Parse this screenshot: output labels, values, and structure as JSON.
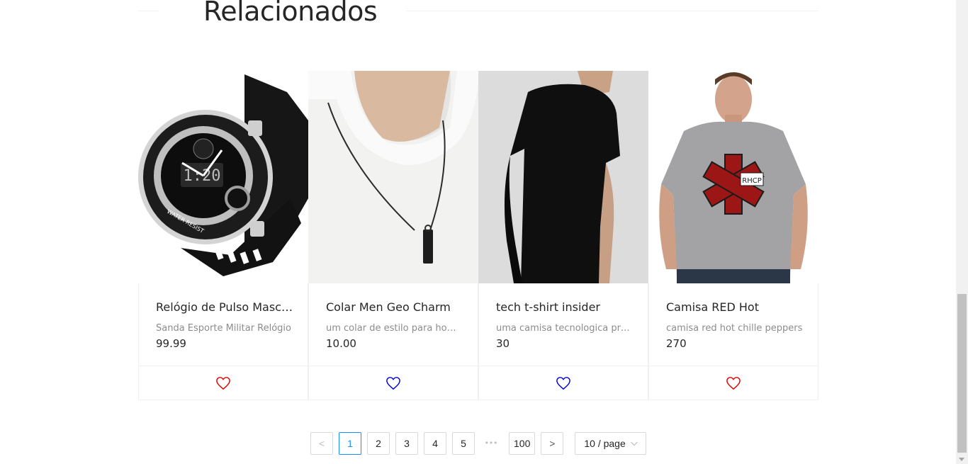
{
  "section": {
    "title": "Relacionados"
  },
  "products": [
    {
      "name": "Relógio de Pulso Masculino",
      "description": "Sanda Esporte Militar Relógio",
      "price": "99.99",
      "favorite_color": "#e00000",
      "image": "watch"
    },
    {
      "name": "Colar Men Geo Charm",
      "description": "um colar de estilo para homens",
      "price": "10.00",
      "favorite_color": "#0000e0",
      "image": "necklace"
    },
    {
      "name": "tech t-shirt insider",
      "description": "uma camisa tecnologica premium",
      "price": "30",
      "favorite_color": "#0000e0",
      "image": "black-tshirt"
    },
    {
      "name": "Camisa RED Hot",
      "description": "camisa red hot chille peppers",
      "price": "270",
      "favorite_color": "#e00000",
      "image": "gray-tshirt"
    }
  ],
  "pagination": {
    "prev": "<",
    "pages": [
      "1",
      "2",
      "3",
      "4",
      "5"
    ],
    "ellipsis": "•••",
    "last": "100",
    "next": ">",
    "current": "1",
    "page_size": "10 / page"
  }
}
